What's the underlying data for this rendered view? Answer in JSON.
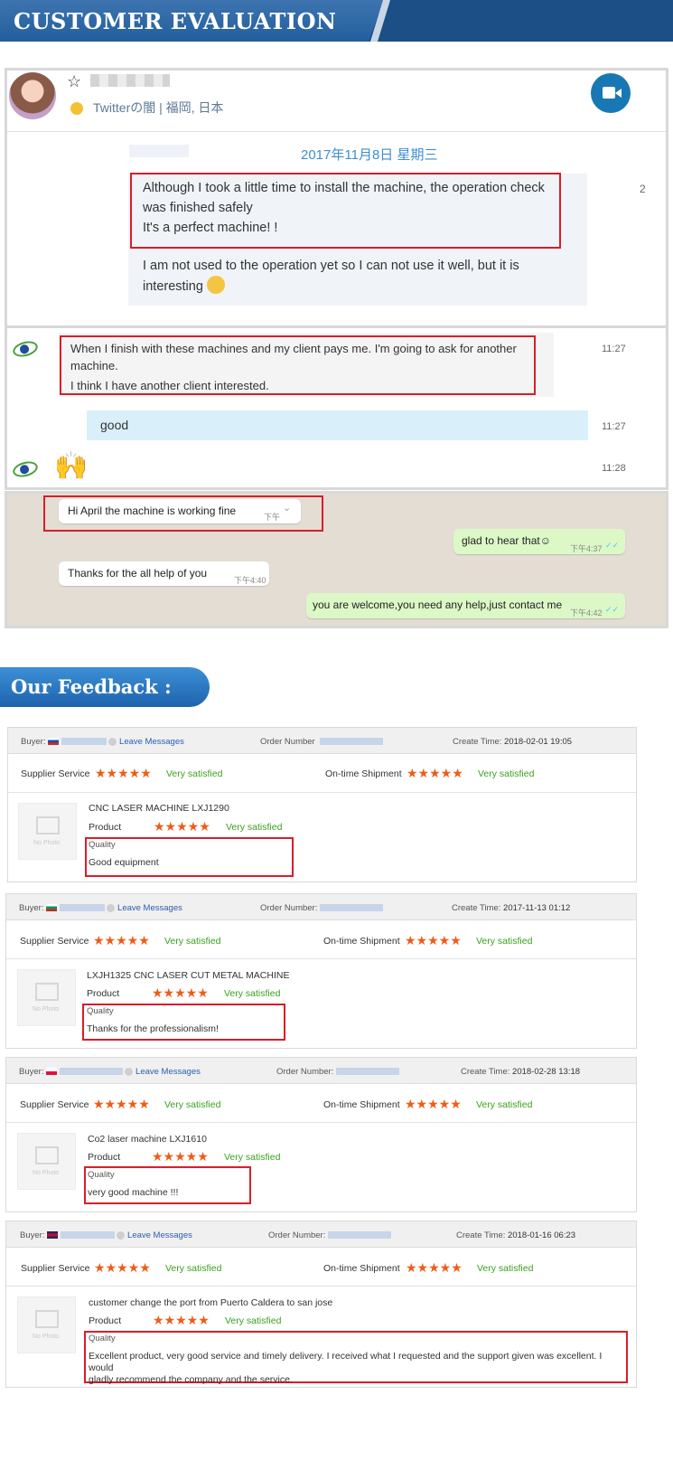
{
  "header": {
    "title": "CUSTOMER EVALUATION"
  },
  "chat1": {
    "source": "Twitterの闇 | 福岡, 日本",
    "date": "2017年11月8日 星期三",
    "msg1_line1": "Although I took a little time to install the machine, the operation check",
    "msg1_line2": "was finished safely",
    "msg1_line3": "It's a perfect machine! !",
    "msg2_line1": "I am not used to the operation yet so I can not use it well, but it is",
    "msg2_line2": "interesting",
    "cut_char": "2"
  },
  "chat2": {
    "msg_line1": "When I finish with these machines and my client pays me. I'm going to ask for another",
    "msg_line2": "machine.",
    "msg_line3": "I think I have another client interested.",
    "time1": "11:27",
    "reply": "good",
    "time2": "11:27",
    "emoji": "🙌",
    "time3": "11:28"
  },
  "chat3": {
    "m1": "Hi April the machine is working fine",
    "m1_time": "下午",
    "m2": "glad to hear that☺",
    "m2_time": "下午4:37",
    "m3": "Thanks for the all help of you",
    "m3_time": "下午4:40",
    "m4": "you are welcome,you need any help,just contact me",
    "m4_time": "下午4:42"
  },
  "feedback": {
    "title": "Our Feedback :",
    "buyer_label": "Buyer:",
    "leave_messages": "Leave Messages",
    "supplier_service": "Supplier Service",
    "ontime_shipment": "On-time Shipment",
    "very_satisfied": "Very satisfied",
    "product_label": "Product",
    "quality_label": "Quality",
    "no_photo": "No Photo",
    "stars": "★★★★★",
    "reviews": [
      {
        "order_label": "Order Number",
        "create_time": "2018-02-01 19:05",
        "product": "CNC LASER MACHINE LXJ1290",
        "quality": "Good equipment"
      },
      {
        "order_label": "Order Number:",
        "create_time": "2017-11-13 01:12",
        "product": "LXJH1325 CNC LASER CUT METAL MACHINE",
        "quality": "Thanks for the professionalism!"
      },
      {
        "order_label": "Order Number:",
        "create_time": "2018-02-28 13:18",
        "product": "Co2 laser machine LXJ1610",
        "quality": "very good machine !!!"
      },
      {
        "order_label": "Order Number:",
        "create_time": "2018-01-16 06:23",
        "product": "customer change the port from Puerto Caldera to san jose",
        "quality_line1": "Excellent product, very good service and timely delivery. I received what I requested and the support given was excellent. I would",
        "quality_line2": "gladly recommend the company and the service."
      }
    ],
    "create_time_label": "Create Time:"
  }
}
